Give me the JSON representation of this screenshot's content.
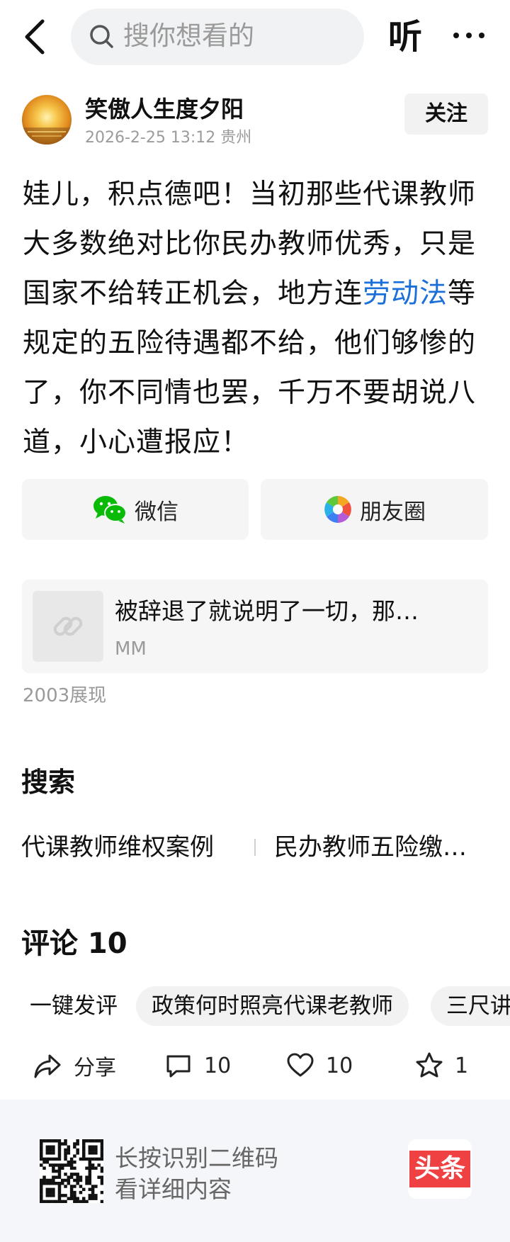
{
  "header": {
    "search_placeholder": "搜你想看的",
    "listen_label": "听"
  },
  "author": {
    "name": "笑傲人生度夕阳",
    "meta": "2026-2-25 13:12 贵州",
    "follow_label": "关注"
  },
  "post": {
    "text_before": "娃儿，积点德吧！当初那些代课教师大多数绝对比你民办教师优秀，只是国家不给转正机会，地方连",
    "link_text": "劳动法",
    "text_after": "等规定的五险待遇都不给，他们够惨的了，你不同情也罢，千万不要胡说八道，小心遭报应！"
  },
  "share": {
    "wechat_label": "微信",
    "moments_label": "朋友圈"
  },
  "linked_card": {
    "title": "被辞退了就说明了一切，那…",
    "source": "MM"
  },
  "views": "2003展现",
  "search_section": {
    "title": "搜索",
    "suggestions": [
      "代课教师维权案例",
      "民办教师五险缴…"
    ]
  },
  "comments": {
    "title": "评论 10",
    "chips": [
      "一键发评",
      "政策何时照亮代课老教师",
      "三尺讲"
    ]
  },
  "actions": {
    "share_label": "分享",
    "comment_count": "10",
    "like_count": "10",
    "star_count": "1"
  },
  "footer": {
    "line1": "长按识别二维码",
    "line2": "看详细内容",
    "brand": "头条"
  },
  "colors": {
    "link": "#1a6fd8",
    "brand_red": "#f04142",
    "wechat_green": "#09bb07"
  }
}
